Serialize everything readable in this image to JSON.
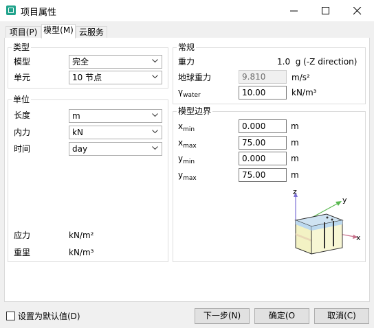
{
  "window": {
    "title": "项目属性",
    "accent": "#21a38c"
  },
  "tabs": [
    {
      "label": "项目(P)"
    },
    {
      "label": "模型(M)",
      "active": true
    },
    {
      "label": "云服务"
    }
  ],
  "type_group": {
    "title": "类型",
    "model_label": "模型",
    "model_value": "完全",
    "unit_label": "单元",
    "unit_value": "10 节点"
  },
  "units_group": {
    "title": "单位",
    "length_label": "长度",
    "length_value": "m",
    "force_label": "内力",
    "force_value": "kN",
    "time_label": "时间",
    "time_value": "day",
    "stress_label": "应力",
    "stress_value": "kN/m²",
    "weight_label": "重里",
    "weight_value": "kN/m³"
  },
  "general_group": {
    "title": "常规",
    "gravity_label": "重力",
    "gravity_value": "1.0  g (-Z direction)",
    "earth_gravity_label": "地球重力",
    "earth_gravity_value": "9.810",
    "earth_gravity_unit": "m/s²",
    "gamma_symbol": "γ",
    "gamma_sub": "water",
    "gamma_value": "10.00",
    "gamma_unit": "kN/m³"
  },
  "bounds_group": {
    "title": "模型边界",
    "rows": [
      {
        "var": "x",
        "sub": "min",
        "value": "0.000",
        "unit": "m"
      },
      {
        "var": "x",
        "sub": "max",
        "value": "75.00",
        "unit": "m"
      },
      {
        "var": "y",
        "sub": "min",
        "value": "0.000",
        "unit": "m"
      },
      {
        "var": "y",
        "sub": "max",
        "value": "75.00",
        "unit": "m"
      }
    ],
    "axis_labels": {
      "z": "z",
      "y": "y",
      "x": "x"
    },
    "axis_colors": {
      "z": "#7b6fd6",
      "y": "#59b84f",
      "x": "#c9738d"
    }
  },
  "footer": {
    "default_label": "设置为默认值(D)",
    "default_checked": false,
    "next_label": "下一步(N)",
    "ok_label": "确定(O",
    "cancel_label": "取消(C)"
  }
}
